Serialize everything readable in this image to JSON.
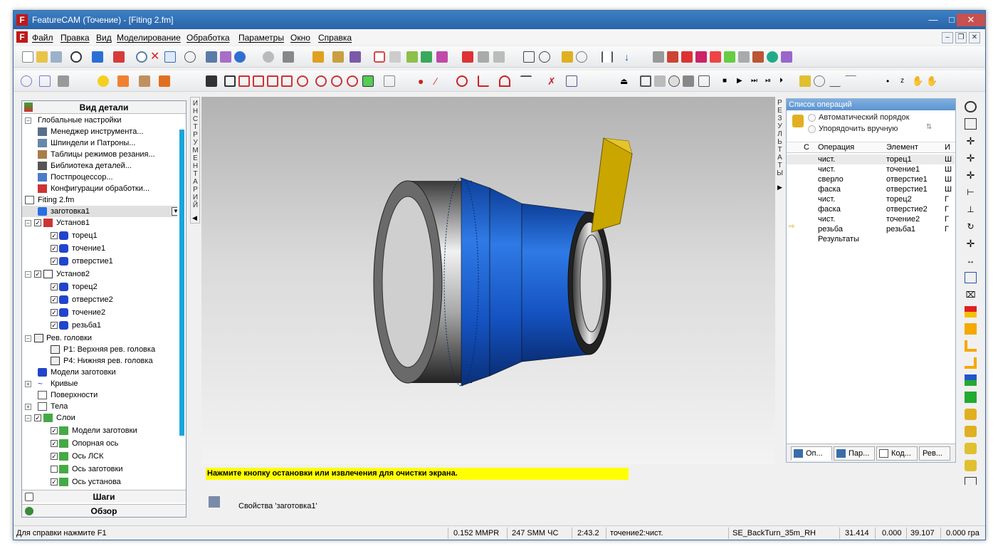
{
  "window": {
    "title": "FeatureCAM (Точение) - [Fiting 2.fm]",
    "app_letter": "F"
  },
  "menu": [
    "Файл",
    "Правка",
    "Вид",
    "Моделирование",
    "Обработка",
    "Параметры",
    "Окно",
    "Справка"
  ],
  "left_panel": {
    "header": "Вид детали",
    "tree": [
      "Глобальные настройки",
      "Менеджер инструмента...",
      "Шпиндели и Патроны...",
      "Таблицы режимов резания...",
      "Библиотека деталей...",
      "Постпроцессор...",
      "Конфигурации обработки...",
      "Fiting 2.fm",
      "заготовка1",
      "Установ1",
      "торец1",
      "точение1",
      "отверстие1",
      "Установ2",
      "торец2",
      "отверстие2",
      "точение2",
      "резьба1",
      "Рев. головки",
      "P1: Верхняя рев. головка",
      "P4: Нижняя рев. головка",
      "Модели заготовки",
      "Кривые",
      "Поверхности",
      "Тела",
      "Слои",
      "Модели заготовки",
      "Опорная ось",
      "Ось ЛСК",
      "Ось заготовки",
      "Ось установа"
    ],
    "bottom_tabs": [
      "Шаги",
      "Обзор"
    ]
  },
  "vertical_tabs": {
    "left": "ИНСТРУМЕНТАРИЙ",
    "right": "РЕЗУЛЬТАТЫ"
  },
  "operations": {
    "title": "Список операций",
    "option_auto": "Автоматический порядок",
    "option_manual": "Упорядочить вручную",
    "columns": [
      "С",
      "Операция",
      "Элемент"
    ],
    "rows": [
      [
        "чист.",
        "торец1",
        "Ш"
      ],
      [
        "чист.",
        "точение1",
        "Ш"
      ],
      [
        "сверло",
        "отверстие1",
        "Ш"
      ],
      [
        "фаска",
        "отверстие1",
        "Ш"
      ],
      [
        "чист.",
        "торец2",
        "Г"
      ],
      [
        "фаска",
        "отверстие2",
        "Г"
      ],
      [
        "чист.",
        "точение2",
        "Г"
      ],
      [
        "резьба",
        "резьба1",
        "Г"
      ]
    ],
    "results_label": "Результаты",
    "tabs": [
      "Оп...",
      "Пар...",
      "Код...",
      "Рев..."
    ]
  },
  "message": "Нажмите кнопку остановки или извлечения для очистки экрана.",
  "properties_label": "Свойства 'заготовка1'",
  "status": {
    "help": "Для справки нажмите F1",
    "feed": "0.152 MMPR",
    "speed": "247 SMM  ЧС",
    "time": "2:43.2",
    "operation": "точение2:чист.",
    "tool": "SE_BackTurn_35m_RH",
    "x": "31.414",
    "y": "0.000",
    "z": "39.107",
    "extra": "0.000 гра"
  }
}
